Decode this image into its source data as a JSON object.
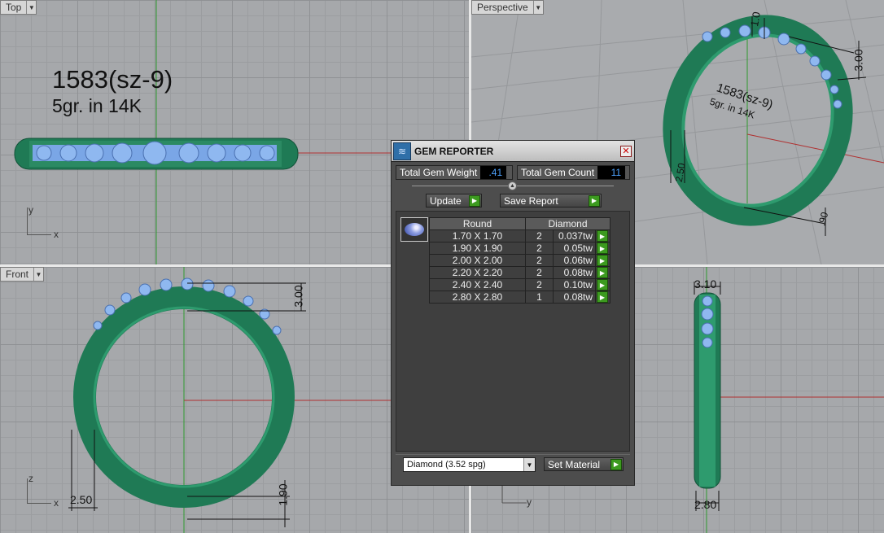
{
  "viewports": {
    "top": {
      "title": "Top",
      "note_line1": "1583(sz-9)",
      "note_line2": "5gr.  in 14K",
      "axis_y": "y",
      "axis_x": "x"
    },
    "perspective": {
      "title": "Perspective",
      "note_line1": "1583(sz-9)",
      "note_line2": "5gr.  in 14K",
      "dim_a": "1.0",
      "dim_b": "3.00",
      "dim_c": "2.50",
      "dim_d": ".90"
    },
    "front": {
      "title": "Front",
      "dim_a": "3.00",
      "dim_b": "2.50",
      "dim_c": "1.90",
      "axis_z": "z",
      "axis_x": "x"
    },
    "right": {
      "dim_a": "3.10",
      "dim_b": "2.80",
      "axis_y": "y"
    }
  },
  "gem_reporter": {
    "title": "GEM REPORTER",
    "total_weight_label": "Total Gem Weight",
    "total_weight_value": ".41",
    "total_count_label": "Total Gem Count",
    "total_count_value": "11",
    "update_label": "Update",
    "save_report_label": "Save Report",
    "col_shape": "Round",
    "col_material": "Diamond",
    "rows": [
      {
        "size": "1.70 X 1.70",
        "count": "2",
        "weight": "0.037tw"
      },
      {
        "size": "1.90 X 1.90",
        "count": "2",
        "weight": "0.05tw"
      },
      {
        "size": "2.00 X 2.00",
        "count": "2",
        "weight": "0.06tw"
      },
      {
        "size": "2.20 X 2.20",
        "count": "2",
        "weight": "0.08tw"
      },
      {
        "size": "2.40 X 2.40",
        "count": "2",
        "weight": "0.10tw"
      },
      {
        "size": "2.80 X 2.80",
        "count": "1",
        "weight": "0.08tw"
      }
    ],
    "material_select": "Diamond      (3.52 spg)",
    "set_material_label": "Set Material"
  },
  "colors": {
    "ring_green": "#1f7a55",
    "gem_blue": "#8fb8f0",
    "x_axis": "#b03030",
    "y_axis": "#2f9a2f"
  }
}
